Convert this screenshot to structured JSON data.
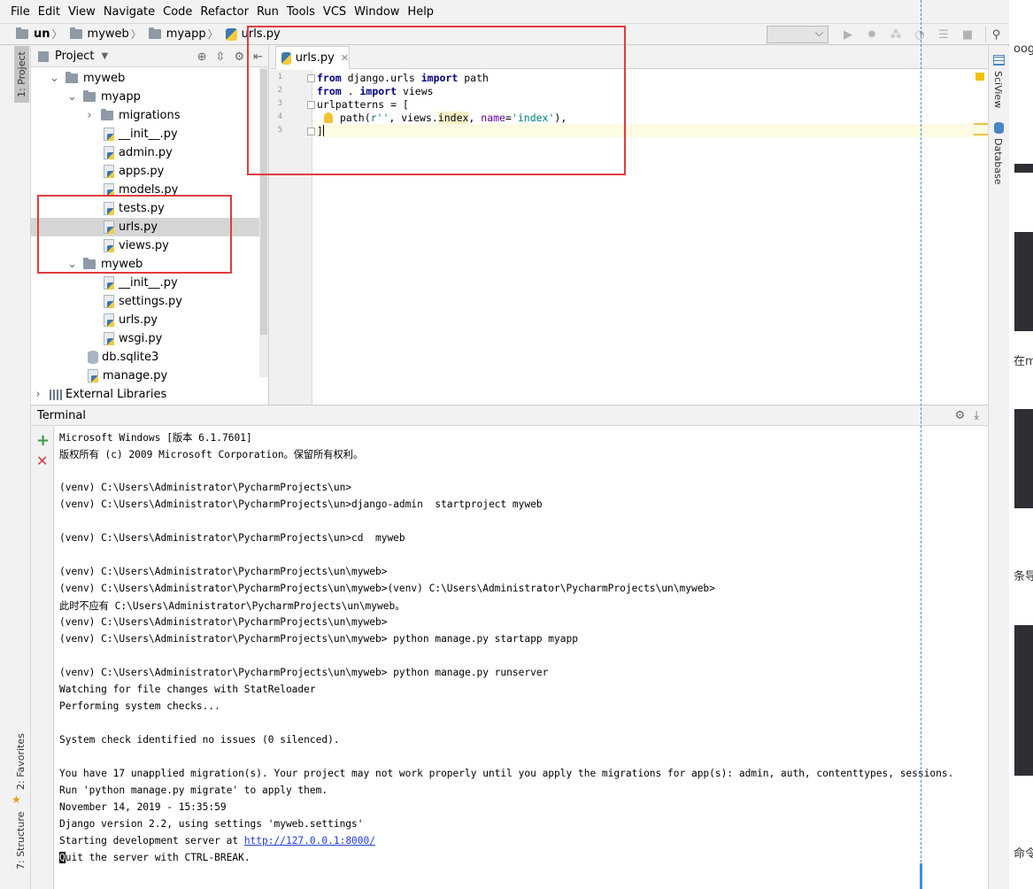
{
  "menu": [
    "File",
    "Edit",
    "View",
    "Navigate",
    "Code",
    "Refactor",
    "Run",
    "Tools",
    "VCS",
    "Window",
    "Help"
  ],
  "breadcrumb": [
    "un",
    "myweb",
    "myapp",
    "urls.py"
  ],
  "left_tabs": {
    "project": "1: Project",
    "favorites": "2: Favorites",
    "structure": "7: Structure"
  },
  "right_tabs": {
    "sciview": "SciView",
    "database": "Database"
  },
  "project_panel": {
    "title": "Project",
    "tree": [
      {
        "label": "myweb",
        "kind": "folder",
        "level": 1,
        "arrow": "⌄"
      },
      {
        "label": "myapp",
        "kind": "folder",
        "level": 2,
        "arrow": "⌄"
      },
      {
        "label": "migrations",
        "kind": "folder",
        "level": 3,
        "arrow": "›"
      },
      {
        "label": "__init__.py",
        "kind": "py",
        "level": 4
      },
      {
        "label": "admin.py",
        "kind": "py",
        "level": 4
      },
      {
        "label": "apps.py",
        "kind": "py",
        "level": 4
      },
      {
        "label": "models.py",
        "kind": "py",
        "level": 4
      },
      {
        "label": "tests.py",
        "kind": "py",
        "level": 4
      },
      {
        "label": "urls.py",
        "kind": "py",
        "level": 4,
        "selected": true
      },
      {
        "label": "views.py",
        "kind": "py",
        "level": 4
      },
      {
        "label": "myweb",
        "kind": "folder",
        "level": 2,
        "arrow": "⌄"
      },
      {
        "label": "__init__.py",
        "kind": "py",
        "level": 4
      },
      {
        "label": "settings.py",
        "kind": "py",
        "level": 4
      },
      {
        "label": "urls.py",
        "kind": "py",
        "level": 4
      },
      {
        "label": "wsgi.py",
        "kind": "py",
        "level": 4
      },
      {
        "label": "db.sqlite3",
        "kind": "db",
        "level": 3
      },
      {
        "label": "manage.py",
        "kind": "py",
        "level": 3
      },
      {
        "label": "External Libraries",
        "kind": "lib",
        "level": 0,
        "arrow": "›"
      }
    ]
  },
  "editor": {
    "tab": "urls.py",
    "line_numbers": [
      "1",
      "2",
      "3",
      "4",
      "5"
    ],
    "code": {
      "l1": {
        "kw1": "from",
        "mod": " django.urls ",
        "kw2": "import",
        "name": " path"
      },
      "l2": {
        "kw1": "from",
        "mod": " . ",
        "kw2": "import",
        "name": " views"
      },
      "l3": "urlpatterns = [",
      "l4": {
        "call": "path(",
        "str1": "r''",
        "mid": ", views.",
        "attr": "index",
        "sep": ", ",
        "kwarg": "name",
        "eq": "=",
        "str2": "'index'",
        "end": "),"
      },
      "l5": "]"
    }
  },
  "terminal": {
    "title": "Terminal",
    "lines": [
      "Microsoft Windows [版本 6.1.7601]",
      "版权所有 (c) 2009 Microsoft Corporation。保留所有权利。",
      "",
      "(venv) C:\\Users\\Administrator\\PycharmProjects\\un>",
      "(venv) C:\\Users\\Administrator\\PycharmProjects\\un>django-admin  startproject myweb",
      "",
      "(venv) C:\\Users\\Administrator\\PycharmProjects\\un>cd  myweb",
      "",
      "(venv) C:\\Users\\Administrator\\PycharmProjects\\un\\myweb>",
      "(venv) C:\\Users\\Administrator\\PycharmProjects\\un\\myweb>(venv) C:\\Users\\Administrator\\PycharmProjects\\un\\myweb>",
      "此时不应有 C:\\Users\\Administrator\\PycharmProjects\\un\\myweb。",
      "(venv) C:\\Users\\Administrator\\PycharmProjects\\un\\myweb>",
      "(venv) C:\\Users\\Administrator\\PycharmProjects\\un\\myweb> python manage.py startapp myapp",
      "",
      "(venv) C:\\Users\\Administrator\\PycharmProjects\\un\\myweb> python manage.py runserver",
      "Watching for file changes with StatReloader",
      "Performing system checks...",
      "",
      "System check identified no issues (0 silenced).",
      "",
      "You have 17 unapplied migration(s). Your project may not work properly until you apply the migrations for app(s): admin, auth, contenttypes, sessions.",
      "Run 'python manage.py migrate' to apply them.",
      "November 14, 2019 - 15:35:59",
      "Django version 2.2, using settings 'myweb.settings'"
    ],
    "server_prefix": "Starting development server at ",
    "server_url": "http://127.0.0.1:8000/",
    "quit_first": "Q",
    "quit_rest": "uit the server with CTRL-BREAK."
  },
  "background_window": {
    "t1": "oog",
    "t2": "在m",
    "t3": "条导",
    "t4": "命令"
  },
  "colors": {
    "annotation_red": "#e23c3c",
    "link": "#2140d8",
    "keyword": "#000080",
    "string": "#008080"
  }
}
